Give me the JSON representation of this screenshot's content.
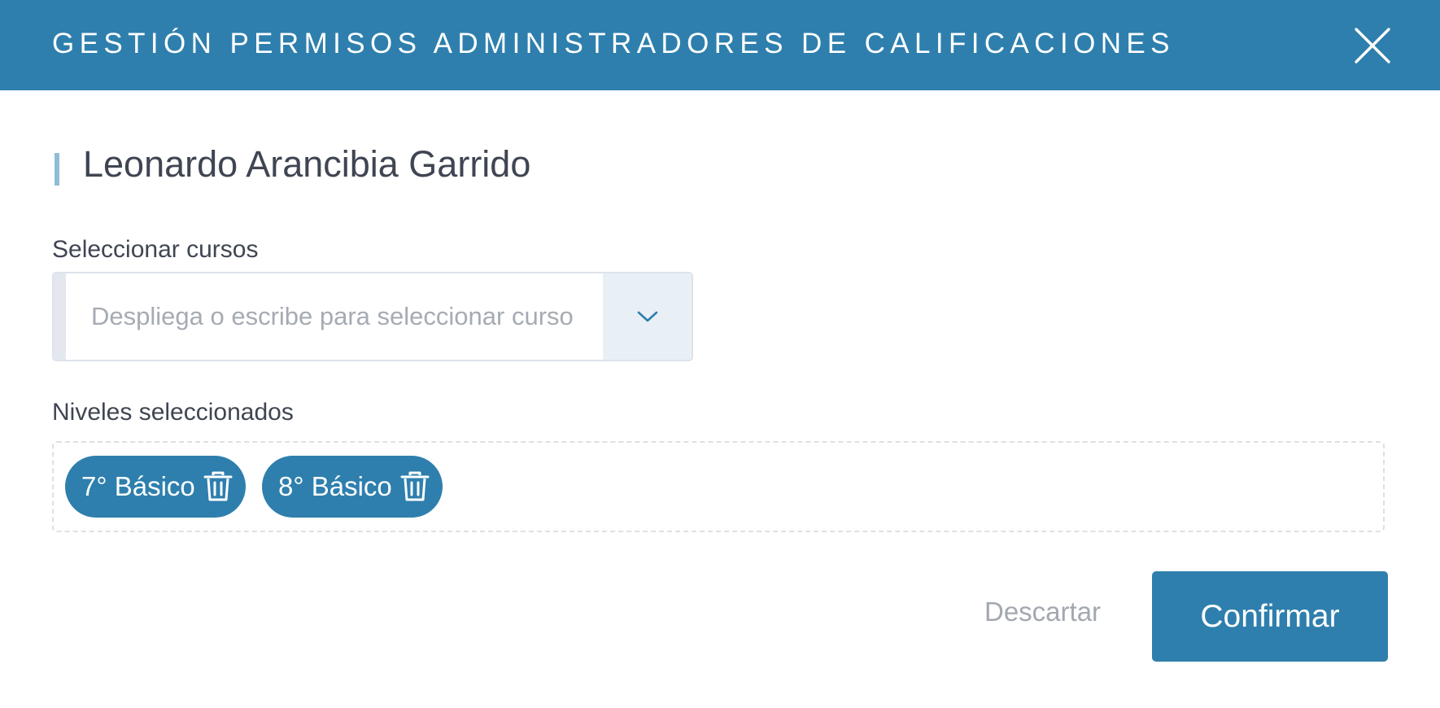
{
  "header": {
    "title": "GESTIÓN PERMISOS ADMINISTRADORES DE CALIFICACIONES",
    "background_color": "#2e7fad",
    "close_icon": "close-icon"
  },
  "person": {
    "name": "Leonardo Arancibia Garrido"
  },
  "course_select": {
    "label": "Seleccionar cursos",
    "placeholder": "Despliega o escribe para seleccionar curso",
    "value": "",
    "toggle_icon": "chevron-down-icon"
  },
  "levels": {
    "label": "Niveles seleccionados",
    "chips": [
      {
        "label": "7° Básico",
        "icon": "trash-icon"
      },
      {
        "label": "8° Básico",
        "icon": "trash-icon"
      }
    ]
  },
  "footer": {
    "discard_label": "Descartar",
    "confirm_label": "Confirmar"
  },
  "colors": {
    "primary": "#2e7fad",
    "text": "#3f4552",
    "muted": "#a3a8b0"
  }
}
